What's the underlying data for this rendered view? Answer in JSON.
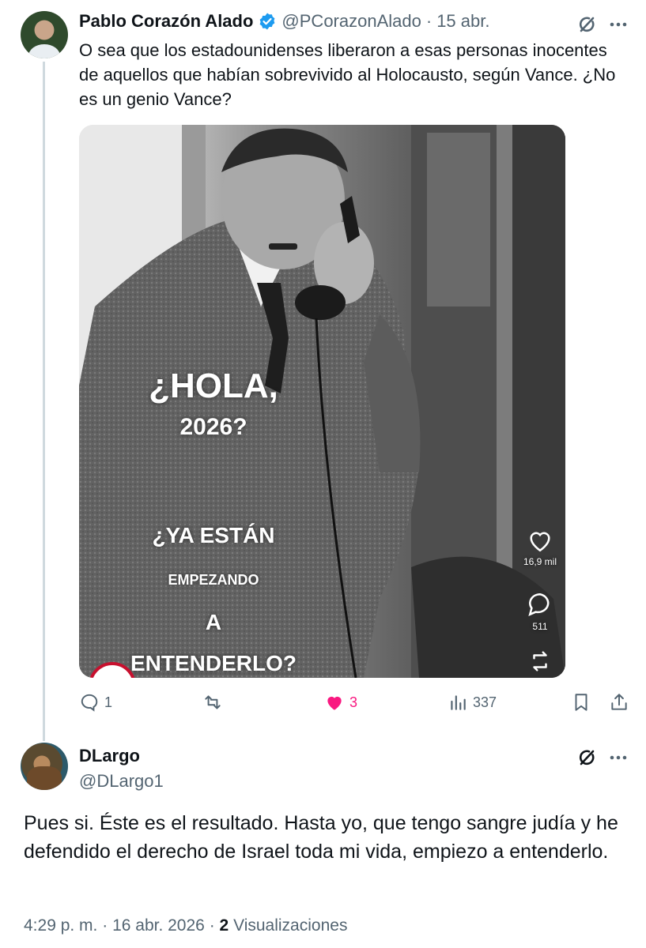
{
  "tweet1": {
    "author_name": "Pablo Corazón Alado",
    "handle": "@PCorazonAlado",
    "dot": "·",
    "date": "15 abr.",
    "text": "O sea que los estadounidenses liberaron a esas personas inocentes de aquellos que habían sobrevivido al Holocausto, según Vance. ¿No es un genio Vance?",
    "media": {
      "line1": "¿HOLA,",
      "line2": "2026?",
      "line3": "¿YA ESTÁN",
      "line4": "EMPEZANDO",
      "line5": "A",
      "line6": "ENTENDERLO?",
      "likes": "16,9 mil",
      "comments": "511"
    },
    "actions": {
      "replies": "1",
      "likes": "3",
      "views": "337"
    },
    "colors": {
      "like_active": "#f91880",
      "verified": "#1d9bf0"
    }
  },
  "tweet2": {
    "author_name": "DLargo",
    "handle": "@DLargo1",
    "text": "Pues si. Éste es el resultado. Hasta yo, que tengo sangre judía y he defendido el derecho de Israel toda mi vida, empiezo a entenderlo.",
    "time": "4:29 p. m.",
    "dot": "·",
    "date": "16 abr. 2026",
    "dot2": "·",
    "views_count": "2",
    "views_label": "Visualizaciones"
  }
}
